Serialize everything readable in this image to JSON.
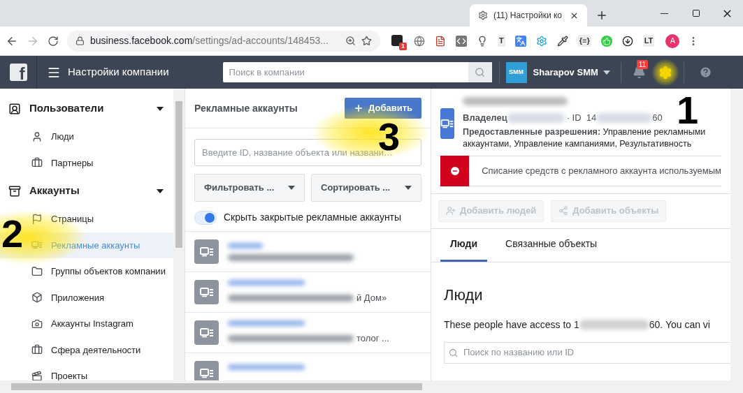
{
  "browser": {
    "tab_title": "(11) Настройки ко",
    "url_domain": "business.facebook.com",
    "url_path": "/settings/ad-accounts/148453...",
    "extensions": [
      {
        "kind": "tile",
        "badge": "1"
      },
      {
        "kind": "globe"
      },
      {
        "kind": "pdf"
      },
      {
        "kind": "code"
      },
      {
        "kind": "bulb"
      },
      {
        "kind": "letter",
        "text": "T"
      },
      {
        "kind": "translate"
      },
      {
        "kind": "gear"
      },
      {
        "kind": "dropper"
      },
      {
        "kind": "letter",
        "text": "{≡}"
      },
      {
        "kind": "thumb"
      },
      {
        "kind": "download"
      },
      {
        "kind": "letter",
        "text": "LT"
      }
    ],
    "profile_initial": "A"
  },
  "header": {
    "logo_letter": "f",
    "title": "Настройки компании",
    "search_placeholder": "Поиск в компании",
    "account_logo": "SMM",
    "account_name": "Sharapov SMM",
    "notifications": "11"
  },
  "sidebar": {
    "sections": [
      {
        "title": "Пользователи",
        "expanded": true,
        "items": [
          {
            "label": "Люди",
            "selected": false
          },
          {
            "label": "Партнеры",
            "selected": false
          }
        ]
      },
      {
        "title": "Аккаунты",
        "expanded": true,
        "items": [
          {
            "label": "Страницы",
            "selected": false
          },
          {
            "label": "Рекламные аккаунты",
            "selected": true
          },
          {
            "label": "Группы объектов компании",
            "selected": false
          },
          {
            "label": "Приложения",
            "selected": false
          },
          {
            "label": "Аккаунты Instagram",
            "selected": false
          },
          {
            "label": "Сфера деятельности",
            "selected": false
          },
          {
            "label": "Проекты",
            "selected": false
          }
        ]
      }
    ]
  },
  "list_panel": {
    "title": "Рекламные аккаунты",
    "add_button": "Добавить",
    "search_placeholder": "Введите ID, название объекта или названи…",
    "filters": [
      "Фильтровать ...",
      "Сортировать ..."
    ],
    "toggle": {
      "label": "Скрыть закрытые рекламные аккаунты",
      "on": true
    },
    "accounts": [
      {
        "kind": "blurred"
      },
      {
        "kind": "partial",
        "visible_tail": "й Дом»"
      },
      {
        "kind": "partial",
        "visible_tail": "толог ..."
      },
      {
        "kind": "blurred"
      }
    ]
  },
  "detail": {
    "owner_label": "Владелец",
    "id_prefix": "· ID  14",
    "id_suffix": "60",
    "permissions_label": "Предоставленные разрешения:",
    "permissions": "Управление рекламными аккаунтами, Управление кампаниями, Результативность",
    "alert": "Списание средств с рекламного аккаунта используемым",
    "actions": [
      {
        "label": "Добавить людей",
        "disabled": true
      },
      {
        "label": "Добавить объекты",
        "disabled": true
      }
    ],
    "tabs": [
      {
        "label": "Люди",
        "selected": true
      },
      {
        "label": "Связанные объекты",
        "selected": false
      }
    ],
    "heading": "Люди",
    "access_prefix": "These people have access to 1",
    "access_suffix": "60. You can vi",
    "search_placeholder": "Поиск по названию или ID"
  },
  "annotations": [
    "1",
    "2",
    "3"
  ]
}
